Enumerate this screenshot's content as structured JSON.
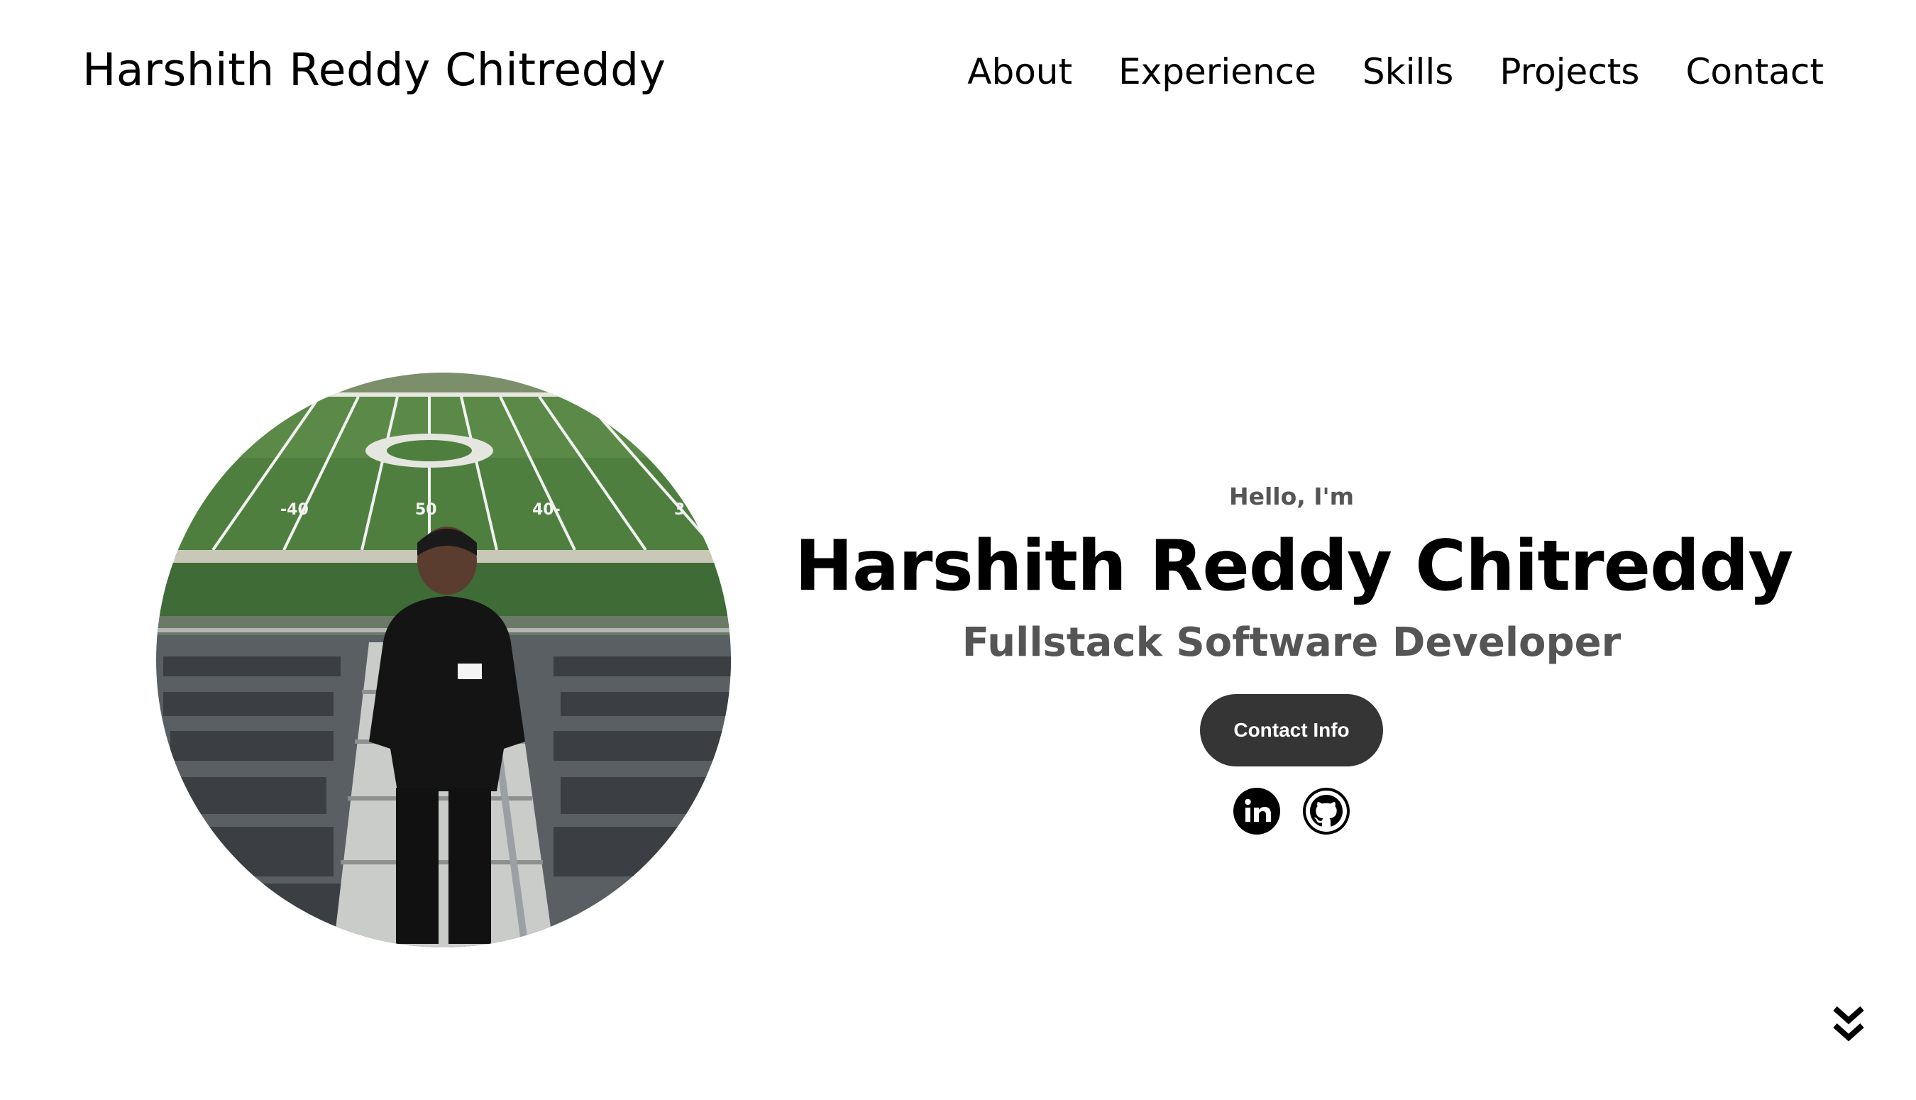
{
  "nav": {
    "logo": "Harshith Reddy Chitreddy",
    "links": [
      "About",
      "Experience",
      "Skills",
      "Projects",
      "Contact"
    ]
  },
  "hero": {
    "greeting": "Hello, I'm",
    "name": "Harshith Reddy Chitreddy",
    "role": "Fullstack Software Developer",
    "contact_button": "Contact Info",
    "socials": [
      {
        "name": "LinkedIn",
        "icon": "linkedin-icon"
      },
      {
        "name": "GitHub",
        "icon": "github-icon"
      }
    ],
    "photo_alt": "profile photo in stadium",
    "scroll_icon": "double-chevron-down-icon"
  },
  "field_markings": [
    "-40",
    "50",
    "40-",
    "3"
  ],
  "colors": {
    "button_bg": "#353535",
    "subtitle": "#555555",
    "turf": "#4a7a3c"
  }
}
